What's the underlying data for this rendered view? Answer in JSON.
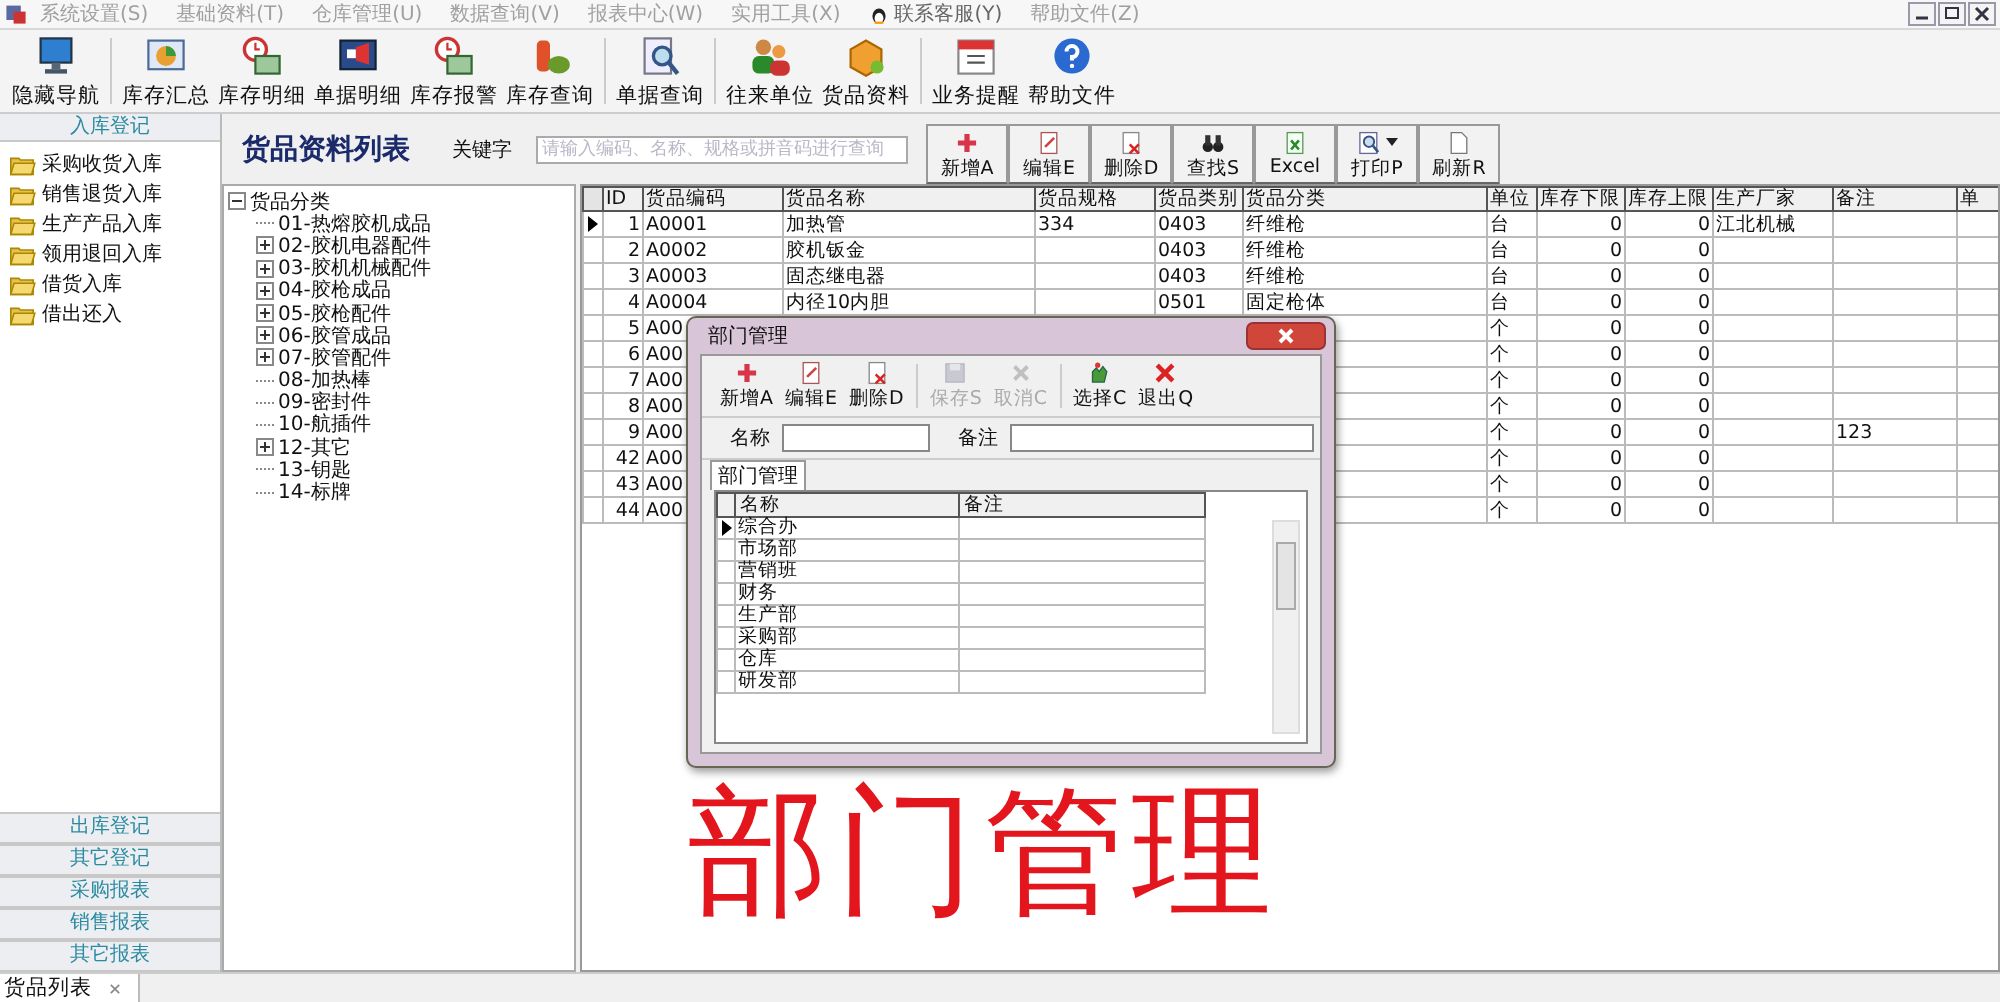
{
  "menu": [
    {
      "label": "系统设置(S)",
      "kind": "plain"
    },
    {
      "label": "基础资料(T)",
      "kind": "plain"
    },
    {
      "label": "仓库管理(U)",
      "kind": "plain"
    },
    {
      "label": "数据查询(V)",
      "kind": "plain"
    },
    {
      "label": "报表中心(W)",
      "kind": "plain"
    },
    {
      "label": "实用工具(X)",
      "kind": "plain"
    },
    {
      "label": "联系客服(Y)",
      "kind": "contact"
    },
    {
      "label": "帮助文件(Z)",
      "kind": "plain"
    }
  ],
  "toolbar": [
    {
      "label": "隐藏导航"
    },
    {
      "label": "库存汇总"
    },
    {
      "label": "库存明细"
    },
    {
      "label": "单据明细"
    },
    {
      "label": "库存报警"
    },
    {
      "label": "库存查询"
    },
    {
      "label": "单据查询"
    },
    {
      "label": "往来单位"
    },
    {
      "label": "货品资料"
    },
    {
      "label": "业务提醒"
    },
    {
      "label": "帮助文件"
    }
  ],
  "sidebar": {
    "header": "入库登记",
    "items": [
      {
        "label": "采购收货入库"
      },
      {
        "label": "销售退货入库"
      },
      {
        "label": "生产产品入库"
      },
      {
        "label": "领用退回入库"
      },
      {
        "label": "借货入库"
      },
      {
        "label": "借出还入"
      }
    ],
    "sections": [
      {
        "label": "出库登记"
      },
      {
        "label": "其它登记"
      },
      {
        "label": "采购报表"
      },
      {
        "label": "销售报表"
      },
      {
        "label": "其它报表"
      }
    ]
  },
  "page_title": "货品资料列表",
  "keyword_label": "关键字",
  "search": {
    "placeholder": "请输入编码、名称、规格或拼音码进行查询"
  },
  "actions": [
    {
      "label": "新增A",
      "dropdown": false
    },
    {
      "label": "编辑E",
      "dropdown": false
    },
    {
      "label": "删除D",
      "dropdown": false
    },
    {
      "label": "查找S",
      "dropdown": false
    },
    {
      "label": "Excel",
      "dropdown": false
    },
    {
      "label": "打印P",
      "dropdown": true
    },
    {
      "label": "刷新R",
      "dropdown": false
    }
  ],
  "tree": {
    "label": "货品分类",
    "expanded": true,
    "children": [
      {
        "label": "01-热熔胶机成品",
        "kind": "leaf"
      },
      {
        "label": "02-胶机电器配件",
        "kind": "folder"
      },
      {
        "label": "03-胶机机械配件",
        "kind": "folder"
      },
      {
        "label": "04-胶枪成品",
        "kind": "folder"
      },
      {
        "label": "05-胶枪配件",
        "kind": "folder"
      },
      {
        "label": "06-胶管成品",
        "kind": "folder"
      },
      {
        "label": "07-胶管配件",
        "kind": "folder"
      },
      {
        "label": "08-加热棒",
        "kind": "leaf"
      },
      {
        "label": "09-密封件",
        "kind": "leaf"
      },
      {
        "label": "10-航插件",
        "kind": "leaf"
      },
      {
        "label": "12-其它",
        "kind": "folder"
      },
      {
        "label": "13-钥匙",
        "kind": "leaf"
      },
      {
        "label": "14-标牌",
        "kind": "leaf"
      }
    ]
  },
  "table": {
    "columns": [
      "ID",
      "货品编码",
      "货品名称",
      "货品规格",
      "货品类别",
      "货品分类",
      "单位",
      "库存下限",
      "库存上限",
      "生产厂家",
      "备注",
      "单"
    ],
    "rows": [
      {
        "selected": true,
        "cells": [
          "1",
          "A0001",
          "加热管",
          "334",
          "0403",
          "纤维枪",
          "台",
          "0",
          "0",
          "江北机械",
          null
        ]
      },
      {
        "selected": false,
        "cells": [
          "2",
          "A0002",
          "胶机钣金",
          null,
          "0403",
          "纤维枪",
          "台",
          "0",
          "0",
          null,
          null
        ]
      },
      {
        "selected": false,
        "cells": [
          "3",
          "A0003",
          "固态继电器",
          null,
          "0403",
          "纤维枪",
          "台",
          "0",
          "0",
          null,
          null
        ]
      },
      {
        "selected": false,
        "cells": [
          "4",
          "A0004",
          "内径10内胆",
          null,
          "0501",
          "固定枪体",
          "台",
          "0",
          "0",
          null,
          null
        ]
      },
      {
        "selected": false,
        "cells": [
          "5",
          "A00",
          null,
          null,
          null,
          null,
          "个",
          "0",
          "0",
          null,
          null
        ]
      },
      {
        "selected": false,
        "cells": [
          "6",
          "A00",
          null,
          null,
          null,
          null,
          "个",
          "0",
          "0",
          null,
          null
        ]
      },
      {
        "selected": false,
        "cells": [
          "7",
          "A00",
          null,
          null,
          null,
          null,
          "个",
          "0",
          "0",
          null,
          null
        ]
      },
      {
        "selected": false,
        "cells": [
          "8",
          "A00",
          null,
          null,
          null,
          null,
          "个",
          "0",
          "0",
          null,
          null
        ]
      },
      {
        "selected": false,
        "cells": [
          "9",
          "A00",
          null,
          null,
          null,
          null,
          "个",
          "0",
          "0",
          null,
          "123"
        ]
      },
      {
        "selected": false,
        "cells": [
          "42",
          "A00",
          null,
          null,
          null,
          null,
          "个",
          "0",
          "0",
          null,
          null
        ]
      },
      {
        "selected": false,
        "cells": [
          "43",
          "A00",
          null,
          null,
          null,
          null,
          "个",
          "0",
          "0",
          null,
          null
        ]
      },
      {
        "selected": false,
        "cells": [
          "44",
          "A00",
          null,
          null,
          null,
          null,
          "个",
          "0",
          "0",
          null,
          null
        ]
      }
    ]
  },
  "dialog": {
    "title": "部门管理",
    "buttons": [
      {
        "label": "新增A",
        "disabled": false
      },
      {
        "label": "编辑E",
        "disabled": false
      },
      {
        "label": "删除D",
        "disabled": false
      },
      {
        "label": "保存S",
        "disabled": true
      },
      {
        "label": "取消C",
        "disabled": true
      },
      {
        "label": "选择C",
        "disabled": false
      },
      {
        "label": "退出Q",
        "disabled": false
      }
    ],
    "fields": [
      {
        "label": "名称"
      },
      {
        "label": "备注"
      }
    ],
    "tab": {
      "label": "部门管理",
      "selected": true
    },
    "columns": [
      "名称",
      "备注"
    ],
    "rows": [
      {
        "name": "综合办",
        "selected": true
      },
      {
        "name": "市场部",
        "selected": false
      },
      {
        "name": "营销班",
        "selected": false
      },
      {
        "name": "财务",
        "selected": false
      },
      {
        "name": "生产部",
        "selected": false
      },
      {
        "name": "采购部",
        "selected": false
      },
      {
        "name": "仓库",
        "selected": false
      },
      {
        "name": "研发部",
        "selected": false
      }
    ]
  },
  "caption": "部门管理",
  "tabs": [
    {
      "label": "货品列表",
      "selected": true
    }
  ]
}
